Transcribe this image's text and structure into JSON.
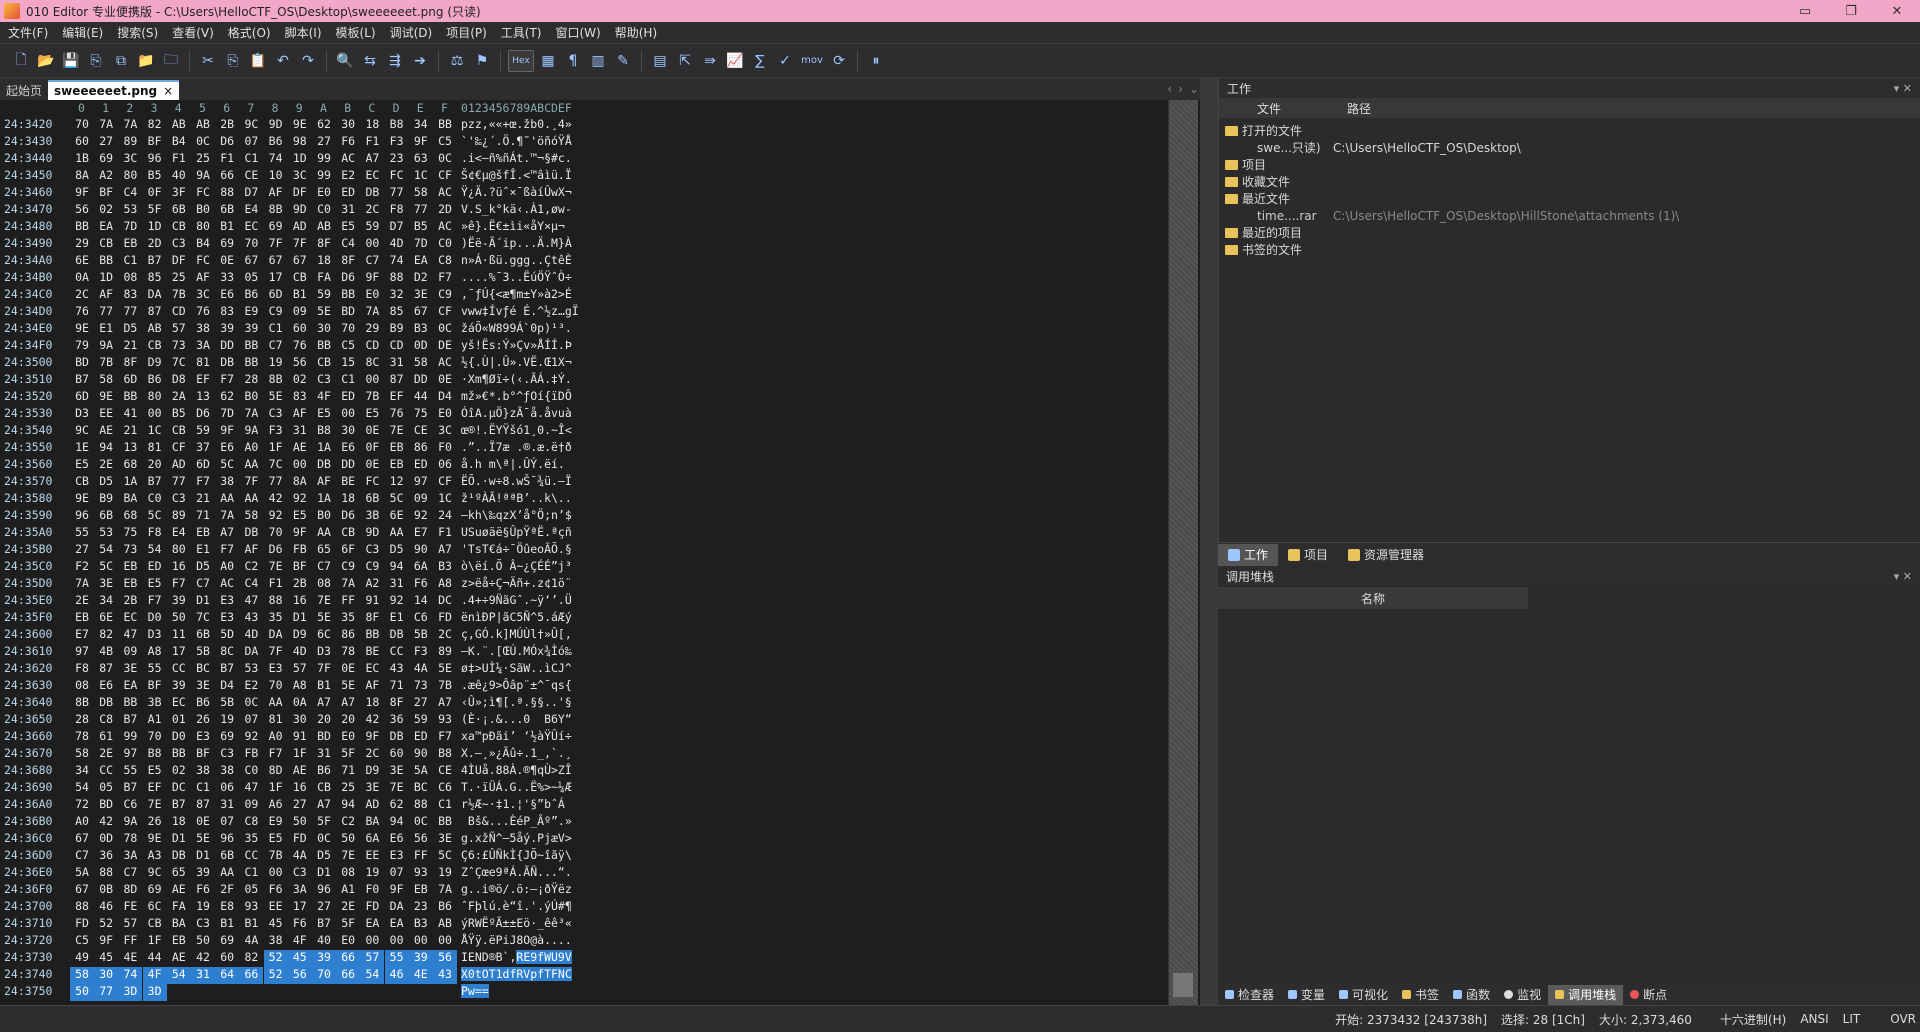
{
  "window": {
    "title": "010 Editor 专业便携版 - C:\\Users\\HelloCTF_OS\\Desktop\\sweeeeeet.png (只读)",
    "min_icon": "minimize-icon",
    "restore_icon": "restore-icon",
    "close_icon": "close-icon"
  },
  "menu": [
    "文件(F)",
    "编辑(E)",
    "搜索(S)",
    "查看(V)",
    "格式(O)",
    "脚本(I)",
    "模板(L)",
    "调试(D)",
    "项目(P)",
    "工具(T)",
    "窗口(W)",
    "帮助(H)"
  ],
  "toolbar": {
    "hex_label": "Hex",
    "mov_label": "mov"
  },
  "tabs": {
    "start": "起始页",
    "file": "sweeeeeet.png",
    "close": "×"
  },
  "editor": {
    "col_headers": [
      "0",
      "1",
      "2",
      "3",
      "4",
      "5",
      "6",
      "7",
      "8",
      "9",
      "A",
      "B",
      "C",
      "D",
      "E",
      "F"
    ],
    "ascii_header": "0123456789ABCDEF",
    "rows": [
      {
        "addr": "24:3420",
        "hex": "70 7A 7A 82 AB AB 2B 9C 9D 9E 62 30 18 B8 34 BB",
        "asc": "pzz‚««+œ.žb0.¸4»"
      },
      {
        "addr": "24:3430",
        "hex": "60 27 89 BF B4 0C D6 07 B6 98 27 F6 F1 F3 9F C5",
        "asc": "`'‰¿´.Ö.¶˜'öñóŸÅ"
      },
      {
        "addr": "24:3440",
        "hex": "1B 69 3C 96 F1 25 F1 C1 74 1D 99 AC A7 23 63 0C",
        "asc": ".i<–ñ%ñÁt.™¬§#c."
      },
      {
        "addr": "24:3450",
        "hex": "8A A2 80 B5 40 9A 66 CE 10 3C 99 E2 EC FC 1C CF",
        "asc": "Š¢€µ@šfÎ.<™âìü.Ï"
      },
      {
        "addr": "24:3460",
        "hex": "9F BF C4 0F 3F FC 88 D7 AF DF E0 ED DB 77 58 AC",
        "asc": "Ÿ¿Ä.?üˆ×¯ßàíÛwX¬"
      },
      {
        "addr": "24:3470",
        "hex": "56 02 53 5F 6B B0 6B E4 8B 9D C0 31 2C F8 77 2D",
        "asc": "V.S_k°kä‹.À1,øw-"
      },
      {
        "addr": "24:3480",
        "hex": "BB EA 7D 1D CB 80 B1 EC 69 AD AB E5 59 D7 B5 AC",
        "asc": "»ê}.Ë€±ìi­«åY×µ¬"
      },
      {
        "addr": "24:3490",
        "hex": "29 CB EB 2D C3 B4 69 70 7F 7F 8F C4 00 4D 7D C0",
        "asc": ")Ëë-Ã´ip...Ä.M}À"
      },
      {
        "addr": "24:34A0",
        "hex": "6E BB C1 B7 DF FC 0E 67 67 67 18 8F C7 74 EA C8",
        "asc": "n»Á·ßü.ggg..ÇtêÈ"
      },
      {
        "addr": "24:34B0",
        "hex": "0A 1D 08 85 25 AF 33 05 17 CB FA D6 9F 88 D2 F7",
        "asc": "....%¯3..ËúÖŸˆÒ÷"
      },
      {
        "addr": "24:34C0",
        "hex": "2C AF 83 DA 7B 3C E6 B6 6D B1 59 BB E0 32 3E C9",
        "asc": ",¯ƒÚ{<æ¶m±Y»à2>É"
      },
      {
        "addr": "24:34D0",
        "hex": "76 77 77 87 CD 76 83 E9 C9 09 5E BD 7A 85 67 CF",
        "asc": "vww‡Ívƒé É.^½z…gÏ"
      },
      {
        "addr": "24:34E0",
        "hex": "9E E1 D5 AB 57 38 39 39 C1 60 30 70 29 B9 B3 0C",
        "asc": "žáÕ«W899Á`0p)¹³."
      },
      {
        "addr": "24:34F0",
        "hex": "79 9A 21 CB 73 3A DD BB C7 76 BB C5 CD CD 0D DE",
        "asc": "yš!Ës:Ý»Çv»ÅÍÍ.Þ"
      },
      {
        "addr": "24:3500",
        "hex": "BD 7B 8F D9 7C 81 DB BB 19 56 CB 15 8C 31 58 AC",
        "asc": "½{.Ù|.Û».VË.Œ1X¬"
      },
      {
        "addr": "24:3510",
        "hex": "B7 58 6D B6 D8 EF F7 28 8B 02 C3 C1 00 87 DD 0E",
        "asc": "·Xm¶Øï÷(‹.ÃÁ.‡Ý."
      },
      {
        "addr": "24:3520",
        "hex": "6D 9E BB 80 2A 13 62 B0 5E 83 4F ED 7B EF 44 D4",
        "asc": "mž»€*.b°^ƒOí{ïDÔ"
      },
      {
        "addr": "24:3530",
        "hex": "D3 EE 41 00 B5 D6 7D 7A C3 AF E5 00 E5 76 75 E0",
        "asc": "ÓîA.µÖ}zÃ¯å.åvuà"
      },
      {
        "addr": "24:3540",
        "hex": "9C AE 21 1C CB 59 9F 9A F3 31 B8 30 0E 7E CE 3C",
        "asc": "œ®!.ËYŸšó1¸0.~Î<"
      },
      {
        "addr": "24:3550",
        "hex": "1E 94 13 81 CF 37 E6 A0 1F AE 1A E6 0F EB 86 F0",
        "asc": ".”..Ï7æ .®.æ.ë†ð"
      },
      {
        "addr": "24:3560",
        "hex": "E5 2E 68 20 AD 6D 5C AA 7C 00 DB DD 0E EB ED 06",
        "asc": "å.h ­m\\ª|.ÛÝ.ëí."
      },
      {
        "addr": "24:3570",
        "hex": "CB D5 1A B7 77 F7 38 7F 77 8A AF BE FC 12 97 CF",
        "asc": "ËÕ.·w÷8.wŠ¯¾ü.—Ï"
      },
      {
        "addr": "24:3580",
        "hex": "9E B9 BA C0 C3 21 AA AA 42 92 1A 18 6B 5C 09 1C",
        "asc": "ž¹ºÀÃ!ªªB’..k\\.."
      },
      {
        "addr": "24:3590",
        "hex": "96 6B 68 5C 89 71 7A 58 92 E5 B0 D6 3B 6E 92 24",
        "asc": "–kh\\‰qzX’å°Ö;n’$"
      },
      {
        "addr": "24:35A0",
        "hex": "55 53 75 F8 E4 EB A7 DB 70 9F AA CB 9D AA E7 F1",
        "asc": "USuøäë§ÛpŸªË.ªçñ"
      },
      {
        "addr": "24:35B0",
        "hex": "27 54 73 54 80 E1 F7 AF D6 FB 65 6F C3 D5 90 A7",
        "asc": "'TsT€á÷¯ÖûeoÃÕ.§"
      },
      {
        "addr": "24:35C0",
        "hex": "F2 5C EB ED 16 D5 A0 C2 7E BF C7 C9 C9 94 6A B3",
        "asc": "ò\\ëí.Õ Â~¿ÇÉÉ”j³"
      },
      {
        "addr": "24:35D0",
        "hex": "7A 3E EB E5 F7 C7 AC C4 F1 2B 08 7A A2 31 F6 A8",
        "asc": "z>ëå÷Ç¬Äñ+.z¢1ö¨"
      },
      {
        "addr": "24:35E0",
        "hex": "2E 34 2B F7 39 D1 E3 47 88 16 7E FF 91 92 14 DC",
        "asc": ".4+÷9ÑãGˆ.~ÿ‘’.Ü"
      },
      {
        "addr": "24:35F0",
        "hex": "EB 6E EC D0 50 7C E3 43 35 D1 5E 35 8F E1 C6 FD",
        "asc": "ënìÐP|ãC5Ñ^5.áÆý"
      },
      {
        "addr": "24:3600",
        "hex": "E7 82 47 D3 11 6B 5D 4D DA D9 6C 86 BB DB 5B 2C",
        "asc": "ç‚GÓ.k]MÚÙl†»Û[,"
      },
      {
        "addr": "24:3610",
        "hex": "97 4B 09 A8 17 5B 8C DA 7F 4D D3 78 BE CC F3 89",
        "asc": "—K.¨.[ŒÚ.MÓx¾Ìó‰"
      },
      {
        "addr": "24:3620",
        "hex": "F8 87 3E 55 CC BC B7 53 E3 57 7F 0E EC 43 4A 5E",
        "asc": "ø‡>UÌ¼·SãW..ìCJ^"
      },
      {
        "addr": "24:3630",
        "hex": "08 E6 EA BF 39 3E D4 E2 70 A8 B1 5E AF 71 73 7B",
        "asc": ".æê¿9>Ôâp¨±^¯qs{"
      },
      {
        "addr": "24:3640",
        "hex": "8B DB BB 3B EC B6 5B 0C AA 0A A7 A7 18 8F 27 A7",
        "asc": "‹Û»;ì¶[.ª.§§..'§"
      },
      {
        "addr": "24:3650",
        "hex": "28 C8 B7 A1 01 26 19 07 81 30 20 20 42 36 59 93",
        "asc": "(È·¡.&...0  B6Y“"
      },
      {
        "addr": "24:3660",
        "hex": "78 61 99 70 D0 E3 69 92 A0 91 BD E0 9F DB ED F7",
        "asc": "xa™pÐãi’ ‘½àŸÛí÷"
      },
      {
        "addr": "24:3670",
        "hex": "58 2E 97 B8 BB BF C3 FB F7 1F 31 5F 2C 60 90 B8",
        "asc": "X.—¸»¿Ãû÷.1_,`.¸"
      },
      {
        "addr": "24:3680",
        "hex": "34 CC 55 E5 02 38 38 C0 8D AE B6 71 D9 3E 5A CE",
        "asc": "4ÌUå.88À.®¶qÙ>ZÎ"
      },
      {
        "addr": "24:3690",
        "hex": "54 05 B7 EF DC C1 06 47 1F 16 CB 25 3E 7E BC C6",
        "asc": "T.·ïÜÁ.G..Ë%>~¼Æ"
      },
      {
        "addr": "24:36A0",
        "hex": "72 BD C6 7E B7 87 31 09 A6 27 A7 94 AD 62 88 C1",
        "asc": "r½Æ~·‡1.¦'§”­bˆÁ"
      },
      {
        "addr": "24:36B0",
        "hex": "A0 42 9A 26 18 0E 07 C8 E9 50 5F C2 BA 94 0C BB",
        "asc": " Bš&...ÈéP_Âº”.»"
      },
      {
        "addr": "24:36C0",
        "hex": "67 0D 78 9E D1 5E 96 35 E5 FD 0C 50 6A E6 56 3E",
        "asc": "g.xžÑ^–5åý.PjæV>"
      },
      {
        "addr": "24:36D0",
        "hex": "C7 36 3A A3 DB D1 6B CC 7B 4A D5 7E EE E3 FF 5C",
        "asc": "Ç6:£ÛÑkÌ{JÕ~îãÿ\\"
      },
      {
        "addr": "24:36E0",
        "hex": "5A 88 C7 9C 65 39 AA C1 00 C3 D1 08 19 07 93 19",
        "asc": "ZˆÇœe9ªÁ.ÃÑ...“."
      },
      {
        "addr": "24:36F0",
        "hex": "67 0B 8D 69 AE F6 2F 05 F6 3A 96 A1 F0 9F EB 7A",
        "asc": "g..i®ö/.ö:–¡ðŸëz"
      },
      {
        "addr": "24:3700",
        "hex": "88 46 FE 6C FA 19 E8 93 EE 17 27 2E FD DA 23 B6",
        "asc": "ˆFþlú.è“î.'.ýÚ#¶"
      },
      {
        "addr": "24:3710",
        "hex": "FD 52 57 CB BA C3 B1 B1 45 F6 B7 5F EA EA B3 AB",
        "asc": "ýRWËºÃ±±Eö·_êê³«"
      },
      {
        "addr": "24:3720",
        "hex": "C5 9F FF 1F EB 50 69 4A 38 4F 40 E0 00 00 00 00",
        "asc": "ÅŸÿ.ëPiJ8O@à...."
      },
      {
        "addr": "24:3730",
        "hex": "49 45 4E 44 AE 42 60 82 52 45 39 66 57 55 39 56",
        "asc": "IEND®B`‚RE9fWU9V",
        "sel_from": 8
      },
      {
        "addr": "24:3740",
        "hex": "58 30 74 4F 54 31 64 66 52 56 70 66 54 46 4E 43",
        "asc": "X0tOT1dfRVpfTFNC",
        "sel_from": 0
      },
      {
        "addr": "24:3750",
        "hex": "50 77 3D 3D",
        "asc": "Pw==",
        "sel_from": 0
      }
    ]
  },
  "workspace": {
    "title": "工作",
    "col_file": "文件",
    "col_path": "路径",
    "open_files_label": "打开的文件",
    "open_file_name": "swe...只读)",
    "open_file_path": "C:\\Users\\HelloCTF_OS\\Desktop\\",
    "projects_label": "项目",
    "favorites_label": "收藏文件",
    "recent_label": "最近文件",
    "recent_file_name": "time....rar",
    "recent_file_path": "C:\\Users\\HelloCTF_OS\\Desktop\\HillStone\\attachments (1)\\",
    "recent_projects_label": "最近的项目",
    "bookmarked_label": "书签的文件"
  },
  "panel_tabs": [
    "工作",
    "项目",
    "资源管理器"
  ],
  "callstack": {
    "title": "调用堆栈",
    "col_name": "名称"
  },
  "bottom_tabs": [
    "检查器",
    "变量",
    "可视化",
    "书签",
    "函数",
    "监视",
    "调用堆栈",
    "断点"
  ],
  "status": {
    "start": "开始: 2373432 [243738h]",
    "selection": "选择: 28 [1Ch]",
    "size": "大小: 2,373,460",
    "encoding_mode": "十六进制(H)",
    "charset": "ANSI",
    "endian": "LIT",
    "ovr": "OVR"
  },
  "colors": {
    "title_bg": "#f2a7c8",
    "selection": "#2f7fd1",
    "editor_bg": "#1e1e1e"
  }
}
